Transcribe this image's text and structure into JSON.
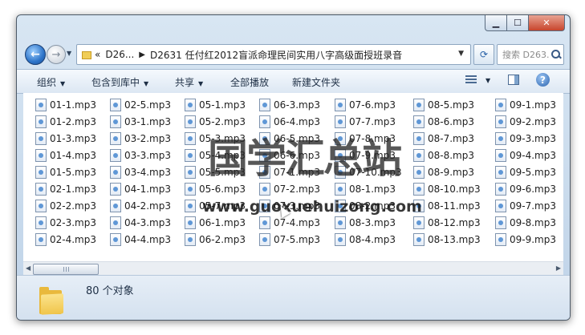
{
  "window": {
    "minimize_label": "▁",
    "maximize_label": "☐",
    "close_label": "✕"
  },
  "address": {
    "overflow": "«",
    "crumb_parent": "D26...",
    "crumb_current": "D2631 任付红2012盲派命理民间实用八字高级面授班录音",
    "search_placeholder": "搜索 D263..."
  },
  "toolbar": {
    "organize": "组织",
    "include_library": "包含到库中",
    "share": "共享",
    "play_all": "全部播放",
    "new_folder": "新建文件夹"
  },
  "files": {
    "columns": [
      [
        "01-1.mp3",
        "01-2.mp3",
        "01-3.mp3",
        "01-4.mp3",
        "01-5.mp3",
        "02-1.mp3",
        "02-2.mp3",
        "02-3.mp3",
        "02-4.mp3"
      ],
      [
        "02-5.mp3",
        "03-1.mp3",
        "03-2.mp3",
        "03-3.mp3",
        "03-4.mp3",
        "04-1.mp3",
        "04-2.mp3",
        "04-3.mp3",
        "04-4.mp3"
      ],
      [
        "05-1.mp3",
        "05-2.mp3",
        "05-3.mp3",
        "05-4.mp3",
        "05-5.mp3",
        "05-6.mp3",
        "05-7.mp3",
        "06-1.mp3",
        "06-2.mp3"
      ],
      [
        "06-3.mp3",
        "06-4.mp3",
        "06-5.mp3",
        "06-6.mp3",
        "07-1.mp3",
        "07-2.mp3",
        "07-3.mp3",
        "07-4.mp3",
        "07-5.mp3"
      ],
      [
        "07-6.mp3",
        "07-7.mp3",
        "07-8.mp3",
        "07-9.mp3",
        "07-10.mp3",
        "08-1.mp3",
        "08-2.mp3",
        "08-3.mp3",
        "08-4.mp3"
      ],
      [
        "08-5.mp3",
        "08-6.mp3",
        "08-7.mp3",
        "08-8.mp3",
        "08-9.mp3",
        "08-10.mp3",
        "08-11.mp3",
        "08-12.mp3",
        "08-13.mp3"
      ],
      [
        "09-1.mp3",
        "09-2.mp3",
        "09-3.mp3",
        "09-4.mp3",
        "09-5.mp3",
        "09-6.mp3",
        "09-7.mp3",
        "09-8.mp3",
        "09-9.mp3"
      ]
    ]
  },
  "watermark": {
    "title": "国学汇总站",
    "url": "www.guoxuehuizong.com"
  },
  "status": {
    "count": "80 个对象"
  },
  "icons": {
    "back": "back-arrow-icon",
    "forward": "forward-arrow-icon",
    "refresh": "refresh-icon",
    "search": "search-icon",
    "file": "mp3-file-icon",
    "folder": "folder-icon",
    "help": "help-icon"
  }
}
